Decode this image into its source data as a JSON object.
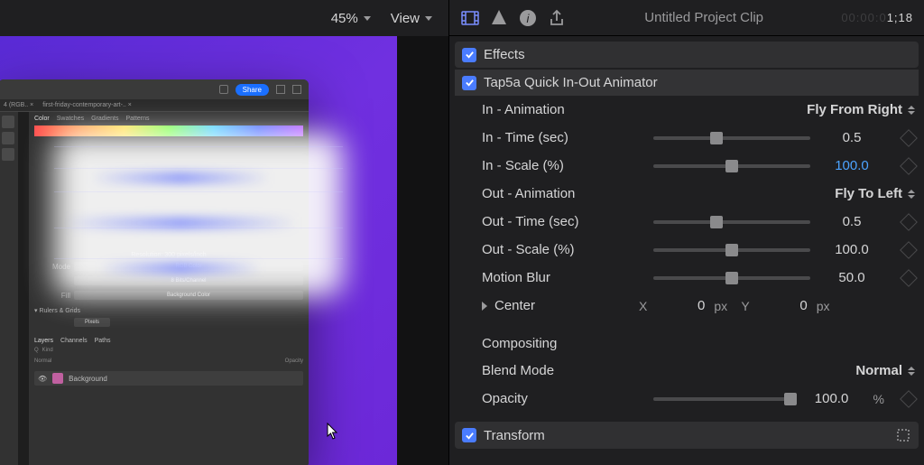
{
  "toolbar": {
    "zoom": "45%",
    "view_label": "View"
  },
  "inspector": {
    "clip_title": "Untitled Project Clip",
    "timecode_prefix": "00:00:0",
    "timecode_frames": "1;18",
    "effects_label": "Effects",
    "effect_name": "Tap5a Quick In-Out Animator",
    "params": {
      "in_anim_label": "In - Animation",
      "in_anim_value": "Fly From Right",
      "in_time_label": "In - Time (sec)",
      "in_time_value": "0.5",
      "in_scale_label": "In - Scale (%)",
      "in_scale_value": "100.0",
      "out_anim_label": "Out - Animation",
      "out_anim_value": "Fly To Left",
      "out_time_label": "Out - Time (sec)",
      "out_time_value": "0.5",
      "out_scale_label": "Out - Scale (%)",
      "out_scale_value": "100.0",
      "mblur_label": "Motion Blur",
      "mblur_value": "50.0",
      "center_label": "Center",
      "center_x_label": "X",
      "center_x_value": "0",
      "center_y_label": "Y",
      "center_y_value": "0",
      "center_unit": "px"
    },
    "compositing_label": "Compositing",
    "blend_label": "Blend Mode",
    "blend_value": "Normal",
    "opacity_label": "Opacity",
    "opacity_value": "100.0",
    "opacity_unit": "%",
    "transform_label": "Transform"
  },
  "ps": {
    "share": "Share",
    "tab1": "4 (RGB.. ×",
    "tab2": "first-friday-contemporary-art-.. ×",
    "color_tabs": [
      "Color",
      "Swatches",
      "Gradients",
      "Patterns"
    ],
    "resolution": "Resolution: 300 pixels/inch",
    "mode_label": "Mode",
    "mode_value": "RGB Color",
    "depth_value": "8 Bits/Channel",
    "fill_label": "Fill",
    "fill_value": "Background Color",
    "rulers_label": "Rulers & Grids",
    "rulers_value": "Pixels",
    "layers_tabs": [
      "Layers",
      "Channels",
      "Paths"
    ],
    "kind_label": "Kind",
    "blend_value": "Normal",
    "opacity_label": "Opacity",
    "layer_name": "Background"
  }
}
